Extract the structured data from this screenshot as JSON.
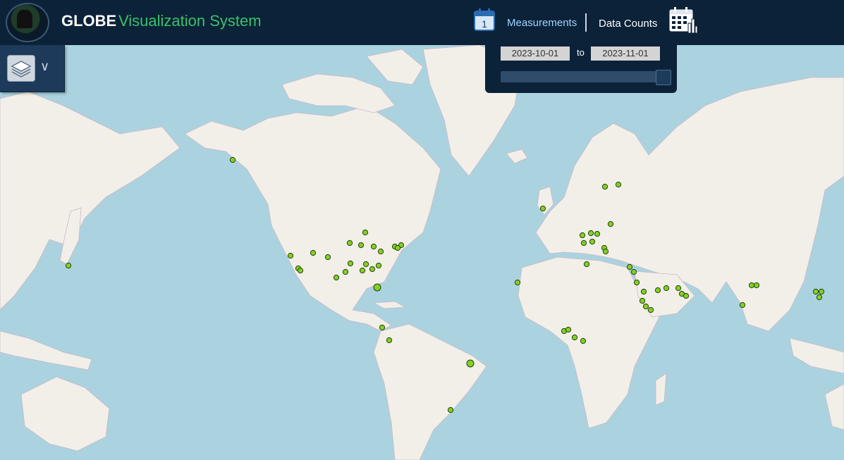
{
  "header": {
    "title_main": "GLOBE",
    "title_sub": "Visualization System",
    "measurements_label": "Measurements",
    "data_counts_label": "Data Counts",
    "calendar_day": "1"
  },
  "time_panel": {
    "start_date": "2023-10-01",
    "to_label": "to",
    "end_date": "2023-11-01",
    "slider_value": 1.0
  },
  "icons": {
    "logo": "globe-logo",
    "calendar": "calendar-icon",
    "data_counts": "data-counts-calendar-icon",
    "layers": "layers-icon",
    "expand": "double-chevron-down-icon"
  },
  "colors": {
    "header_bg": "#0b2238",
    "title_accent": "#39c26b",
    "link": "#9fd4ff",
    "ocean": "#aad3df",
    "land": "#f2efe9",
    "point": "#7ed321"
  }
}
